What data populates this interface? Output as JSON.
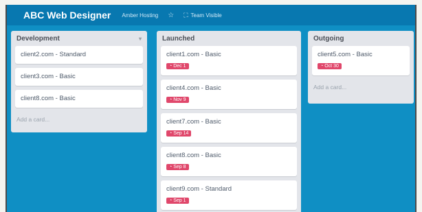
{
  "board": {
    "title": "ABC Web Designer",
    "org": "Amber Hosting",
    "team_label": "Team Visible",
    "star_icon": "star-icon",
    "team_icon": "team-icon"
  },
  "lists": [
    {
      "title": "Development",
      "cards": [
        {
          "title": "client2.com - Standard"
        },
        {
          "title": "client3.com - Basic"
        },
        {
          "title": "client8.com - Basic"
        }
      ],
      "add_card": "Add a card..."
    },
    {
      "title": "Launched",
      "cards": [
        {
          "title": "client1.com - Basic",
          "due": "Dec 1"
        },
        {
          "title": "client4.com - Basic",
          "due": "Nov 9"
        },
        {
          "title": "client7.com - Basic",
          "due": "Sep 14"
        },
        {
          "title": "client8.com - Basic",
          "due": "Sep 8"
        },
        {
          "title": "client9.com - Standard",
          "due": "Sep 1"
        }
      ]
    },
    {
      "title": "Outgoing",
      "cards": [
        {
          "title": "client5.com - Basic",
          "due": "Oct 30"
        }
      ],
      "add_card": "Add a card..."
    }
  ],
  "colors": {
    "board_bg": "#0f8fc4",
    "topbar_bg": "#0878b0",
    "list_bg": "#e3e5ea",
    "due_badge": "#e0476b"
  }
}
